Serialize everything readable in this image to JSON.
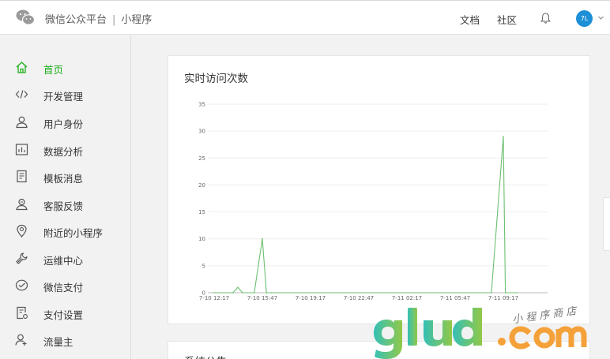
{
  "header": {
    "platform": "微信公众平台",
    "separator": "|",
    "product": "小程序",
    "links": [
      "文档",
      "社区"
    ],
    "avatar_text": "7L"
  },
  "sidebar": {
    "items": [
      {
        "label": "首页",
        "icon": "home-icon",
        "active": true
      },
      {
        "label": "开发管理",
        "icon": "code-icon",
        "active": false
      },
      {
        "label": "用户身份",
        "icon": "user-icon",
        "active": false
      },
      {
        "label": "数据分析",
        "icon": "bar-chart-icon",
        "active": false
      },
      {
        "label": "模板消息",
        "icon": "document-icon",
        "active": false
      },
      {
        "label": "客服反馈",
        "icon": "customer-service-icon",
        "active": false
      },
      {
        "label": "附近的小程序",
        "icon": "location-pin-icon",
        "active": false
      },
      {
        "label": "运维中心",
        "icon": "wrench-icon",
        "active": false
      },
      {
        "label": "微信支付",
        "icon": "wechat-pay-icon",
        "active": false
      },
      {
        "label": "支付设置",
        "icon": "payment-settings-icon",
        "active": false
      },
      {
        "label": "流量主",
        "icon": "traffic-owner-icon",
        "active": false
      }
    ]
  },
  "visits_card": {
    "title": "实时访问次数"
  },
  "announcement_card": {
    "title": "系统公告"
  },
  "colors": {
    "accent": "#1aad19",
    "line": "#6cc070",
    "avatar": "#1d8fd6"
  },
  "chart_data": {
    "type": "line",
    "title": "实时访问次数",
    "xlabel": "",
    "ylabel": "",
    "ylim": [
      0,
      35
    ],
    "yticks": [
      "0",
      "5",
      "10",
      "15",
      "20",
      "25",
      "30",
      "35"
    ],
    "xticks": [
      "7-10 12:17",
      "7-10 15:47",
      "7-10 19:17",
      "7-10 22:47",
      "7-11 02:17",
      "7-11 05:47",
      "7-11 09:17"
    ],
    "x": [
      "7-10 12:17",
      "7-10 13:39",
      "7-10 14:00",
      "7-10 14:21",
      "7-10 15:12",
      "7-10 15:47",
      "7-10 16:05",
      "7-10 16:26",
      "7-11 08:25",
      "7-11 09:17",
      "7-11 09:26",
      "7-11 10:18"
    ],
    "series": [
      {
        "values": [
          0,
          0,
          1,
          0,
          0,
          10,
          0,
          0,
          0,
          29,
          0,
          0
        ]
      }
    ],
    "grid": true,
    "legend": "none"
  }
}
